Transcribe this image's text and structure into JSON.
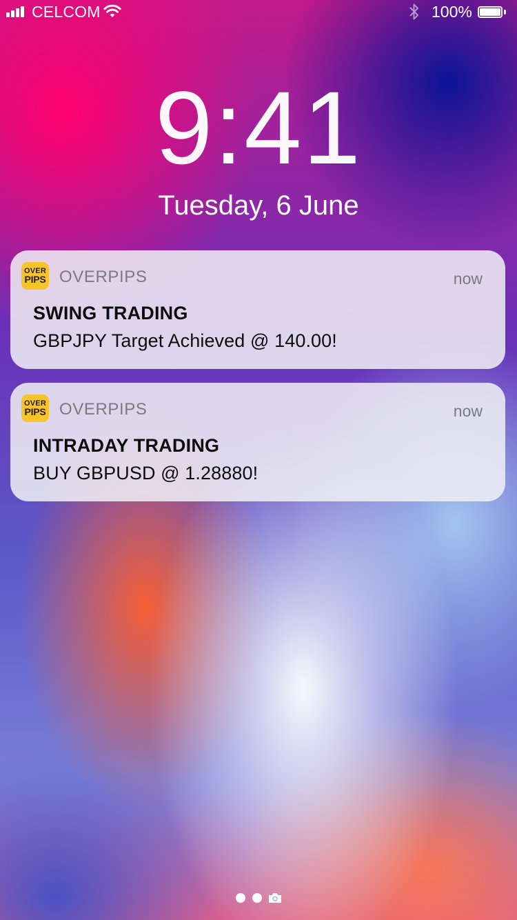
{
  "status_bar": {
    "carrier": "CELCOM",
    "battery_percent": "100%",
    "battery_level": 1.0,
    "icons": [
      "signal-bars-icon",
      "wifi-icon",
      "bluetooth-icon",
      "battery-icon"
    ]
  },
  "lock_screen": {
    "time": "9:41",
    "date": "Tuesday, 6 June"
  },
  "notifications": [
    {
      "app_icon_text": [
        "OVER",
        "PIPS"
      ],
      "app_name": "OVERPIPS",
      "time": "now",
      "title": "SWING TRADING",
      "body": "GBPJPY Target Achieved @ 140.00!"
    },
    {
      "app_icon_text": [
        "OVER",
        "PIPS"
      ],
      "app_name": "OVERPIPS",
      "time": "now",
      "title": "INTRADAY TRADING",
      "body": "BUY GBPUSD @ 1.28880!"
    }
  ],
  "page_indicator": {
    "pages": 2,
    "current": 1,
    "extra_icon": "camera-icon"
  },
  "colors": {
    "app_icon_bg": "#f7c52b",
    "card_bg": "#f0f0f5"
  }
}
